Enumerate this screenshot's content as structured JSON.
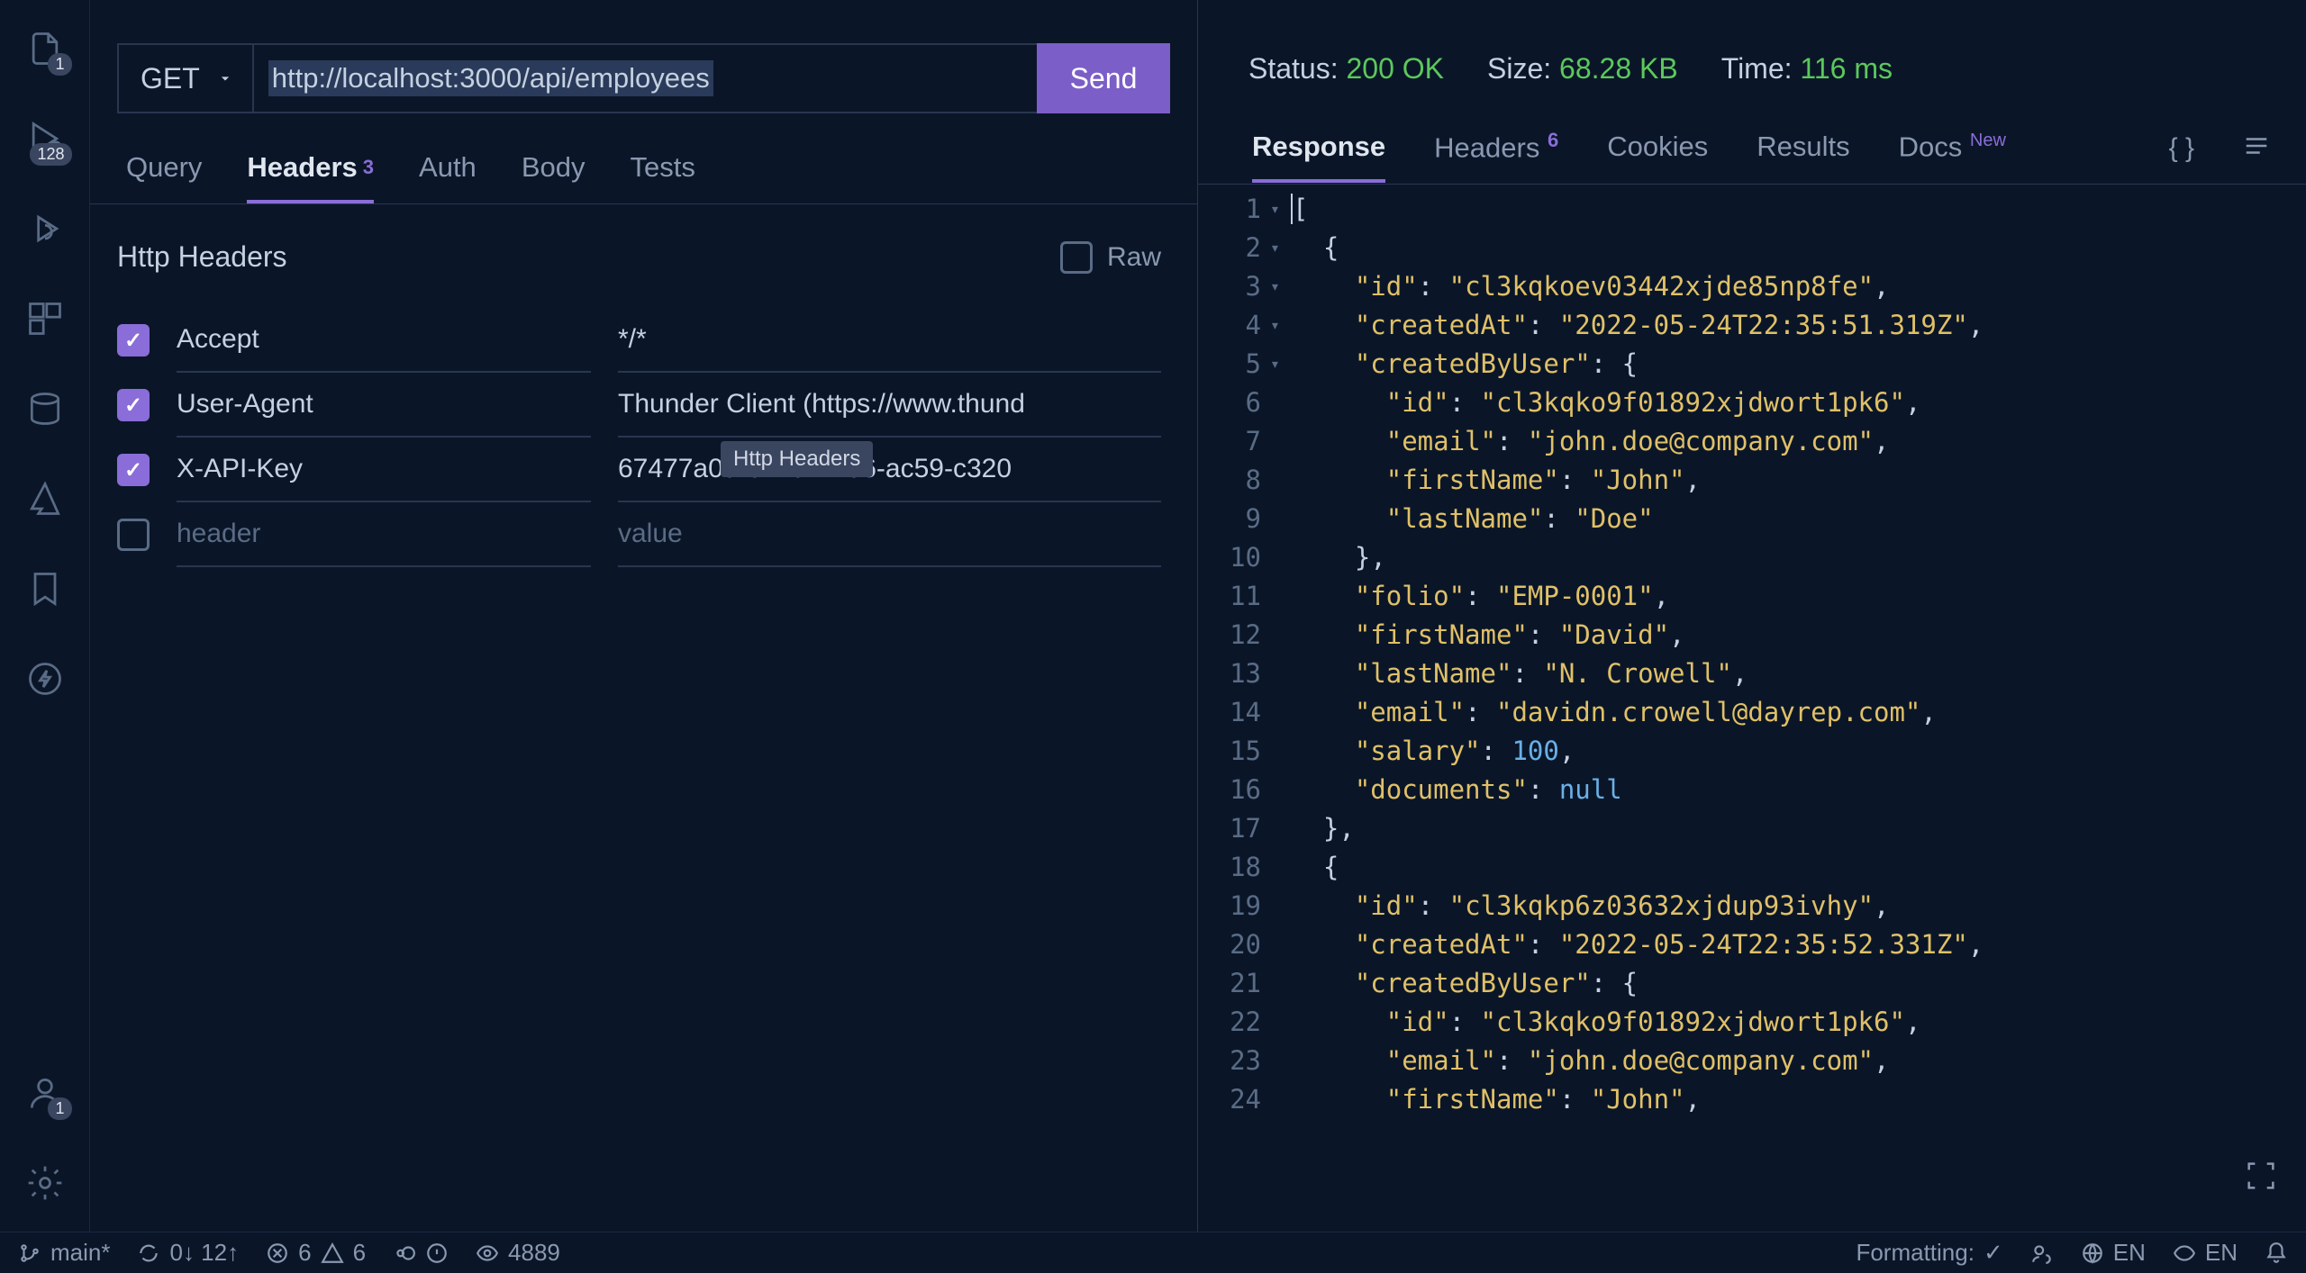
{
  "activity": {
    "explorer_badge": "1",
    "extensions_badge": "128"
  },
  "request": {
    "method": "GET",
    "url": "http://localhost:3000/api/employees",
    "send_label": "Send",
    "tabs": {
      "query": "Query",
      "headers": "Headers",
      "headers_badge": "3",
      "auth": "Auth",
      "body": "Body",
      "tests": "Tests"
    },
    "headers_title": "Http Headers",
    "raw_label": "Raw",
    "tooltip": "Http Headers",
    "rows": [
      {
        "checked": true,
        "key": "Accept",
        "value": "*/*"
      },
      {
        "checked": true,
        "key": "User-Agent",
        "value": "Thunder Client (https://www.thund"
      },
      {
        "checked": true,
        "key": "X-API-Key",
        "value": "67477a0d-041a-4186-ac59-c320"
      }
    ],
    "placeholder_key": "header",
    "placeholder_value": "value"
  },
  "response": {
    "status_label": "Status:",
    "status_value": "200 OK",
    "size_label": "Size:",
    "size_value": "68.28 KB",
    "time_label": "Time:",
    "time_value": "116 ms",
    "tabs": {
      "response": "Response",
      "headers": "Headers",
      "headers_badge": "6",
      "cookies": "Cookies",
      "results": "Results",
      "docs": "Docs",
      "docs_badge": "New"
    },
    "json_lines": [
      {
        "n": 1,
        "fold": "▾",
        "tokens": [
          [
            "brace",
            "["
          ]
        ],
        "cursor": true
      },
      {
        "n": 2,
        "fold": "▾",
        "indent": 1,
        "tokens": [
          [
            "brace",
            "{"
          ]
        ]
      },
      {
        "n": 3,
        "indent": 2,
        "tokens": [
          [
            "key",
            "\"id\""
          ],
          [
            "punc",
            ": "
          ],
          [
            "str",
            "\"cl3kqkoev03442xjde85np8fe\""
          ],
          [
            "punc",
            ","
          ]
        ]
      },
      {
        "n": 4,
        "indent": 2,
        "tokens": [
          [
            "key",
            "\"createdAt\""
          ],
          [
            "punc",
            ": "
          ],
          [
            "str",
            "\"2022-05-24T22:35:51.319Z\""
          ],
          [
            "punc",
            ","
          ]
        ]
      },
      {
        "n": 5,
        "fold": "▾",
        "indent": 2,
        "tokens": [
          [
            "key",
            "\"createdByUser\""
          ],
          [
            "punc",
            ": "
          ],
          [
            "brace",
            "{"
          ]
        ]
      },
      {
        "n": 6,
        "indent": 3,
        "tokens": [
          [
            "key",
            "\"id\""
          ],
          [
            "punc",
            ": "
          ],
          [
            "str",
            "\"cl3kqko9f01892xjdwort1pk6\""
          ],
          [
            "punc",
            ","
          ]
        ]
      },
      {
        "n": 7,
        "indent": 3,
        "tokens": [
          [
            "key",
            "\"email\""
          ],
          [
            "punc",
            ": "
          ],
          [
            "str",
            "\"john.doe@company.com\""
          ],
          [
            "punc",
            ","
          ]
        ]
      },
      {
        "n": 8,
        "indent": 3,
        "tokens": [
          [
            "key",
            "\"firstName\""
          ],
          [
            "punc",
            ": "
          ],
          [
            "str",
            "\"John\""
          ],
          [
            "punc",
            ","
          ]
        ]
      },
      {
        "n": 9,
        "indent": 3,
        "tokens": [
          [
            "key",
            "\"lastName\""
          ],
          [
            "punc",
            ": "
          ],
          [
            "str",
            "\"Doe\""
          ]
        ]
      },
      {
        "n": 10,
        "indent": 2,
        "tokens": [
          [
            "brace",
            "}"
          ],
          [
            "punc",
            ","
          ]
        ]
      },
      {
        "n": 11,
        "indent": 2,
        "tokens": [
          [
            "key",
            "\"folio\""
          ],
          [
            "punc",
            ": "
          ],
          [
            "str",
            "\"EMP-0001\""
          ],
          [
            "punc",
            ","
          ]
        ]
      },
      {
        "n": 12,
        "indent": 2,
        "tokens": [
          [
            "key",
            "\"firstName\""
          ],
          [
            "punc",
            ": "
          ],
          [
            "str",
            "\"David\""
          ],
          [
            "punc",
            ","
          ]
        ]
      },
      {
        "n": 13,
        "indent": 2,
        "tokens": [
          [
            "key",
            "\"lastName\""
          ],
          [
            "punc",
            ": "
          ],
          [
            "str",
            "\"N. Crowell\""
          ],
          [
            "punc",
            ","
          ]
        ]
      },
      {
        "n": 14,
        "indent": 2,
        "tokens": [
          [
            "key",
            "\"email\""
          ],
          [
            "punc",
            ": "
          ],
          [
            "str",
            "\"davidn.crowell@dayrep.com\""
          ],
          [
            "punc",
            ","
          ]
        ]
      },
      {
        "n": 15,
        "indent": 2,
        "tokens": [
          [
            "key",
            "\"salary\""
          ],
          [
            "punc",
            ": "
          ],
          [
            "num",
            "100"
          ],
          [
            "punc",
            ","
          ]
        ]
      },
      {
        "n": 16,
        "indent": 2,
        "tokens": [
          [
            "key",
            "\"documents\""
          ],
          [
            "punc",
            ": "
          ],
          [
            "null",
            "null"
          ]
        ]
      },
      {
        "n": 17,
        "indent": 1,
        "tokens": [
          [
            "brace",
            "}"
          ],
          [
            "punc",
            ","
          ]
        ]
      },
      {
        "n": 18,
        "fold": "▾",
        "indent": 1,
        "tokens": [
          [
            "brace",
            "{"
          ]
        ]
      },
      {
        "n": 19,
        "indent": 2,
        "tokens": [
          [
            "key",
            "\"id\""
          ],
          [
            "punc",
            ": "
          ],
          [
            "str",
            "\"cl3kqkp6z03632xjdup93ivhy\""
          ],
          [
            "punc",
            ","
          ]
        ]
      },
      {
        "n": 20,
        "indent": 2,
        "tokens": [
          [
            "key",
            "\"createdAt\""
          ],
          [
            "punc",
            ": "
          ],
          [
            "str",
            "\"2022-05-24T22:35:52.331Z\""
          ],
          [
            "punc",
            ","
          ]
        ]
      },
      {
        "n": 21,
        "fold": "▾",
        "indent": 2,
        "tokens": [
          [
            "key",
            "\"createdByUser\""
          ],
          [
            "punc",
            ": "
          ],
          [
            "brace",
            "{"
          ]
        ]
      },
      {
        "n": 22,
        "indent": 3,
        "tokens": [
          [
            "key",
            "\"id\""
          ],
          [
            "punc",
            ": "
          ],
          [
            "str",
            "\"cl3kqko9f01892xjdwort1pk6\""
          ],
          [
            "punc",
            ","
          ]
        ]
      },
      {
        "n": 23,
        "indent": 3,
        "tokens": [
          [
            "key",
            "\"email\""
          ],
          [
            "punc",
            ": "
          ],
          [
            "str",
            "\"john.doe@company.com\""
          ],
          [
            "punc",
            ","
          ]
        ]
      },
      {
        "n": 24,
        "indent": 3,
        "tokens": [
          [
            "key",
            "\"firstName\""
          ],
          [
            "punc",
            ": "
          ],
          [
            "str",
            "\"John\""
          ],
          [
            "punc",
            ","
          ]
        ]
      }
    ]
  },
  "statusbar": {
    "branch": "main*",
    "sync": "0↓ 12↑",
    "errors": "6",
    "warnings": "6",
    "ports": "4889",
    "formatting": "Formatting:",
    "lang1": "EN",
    "lang2": "EN"
  }
}
